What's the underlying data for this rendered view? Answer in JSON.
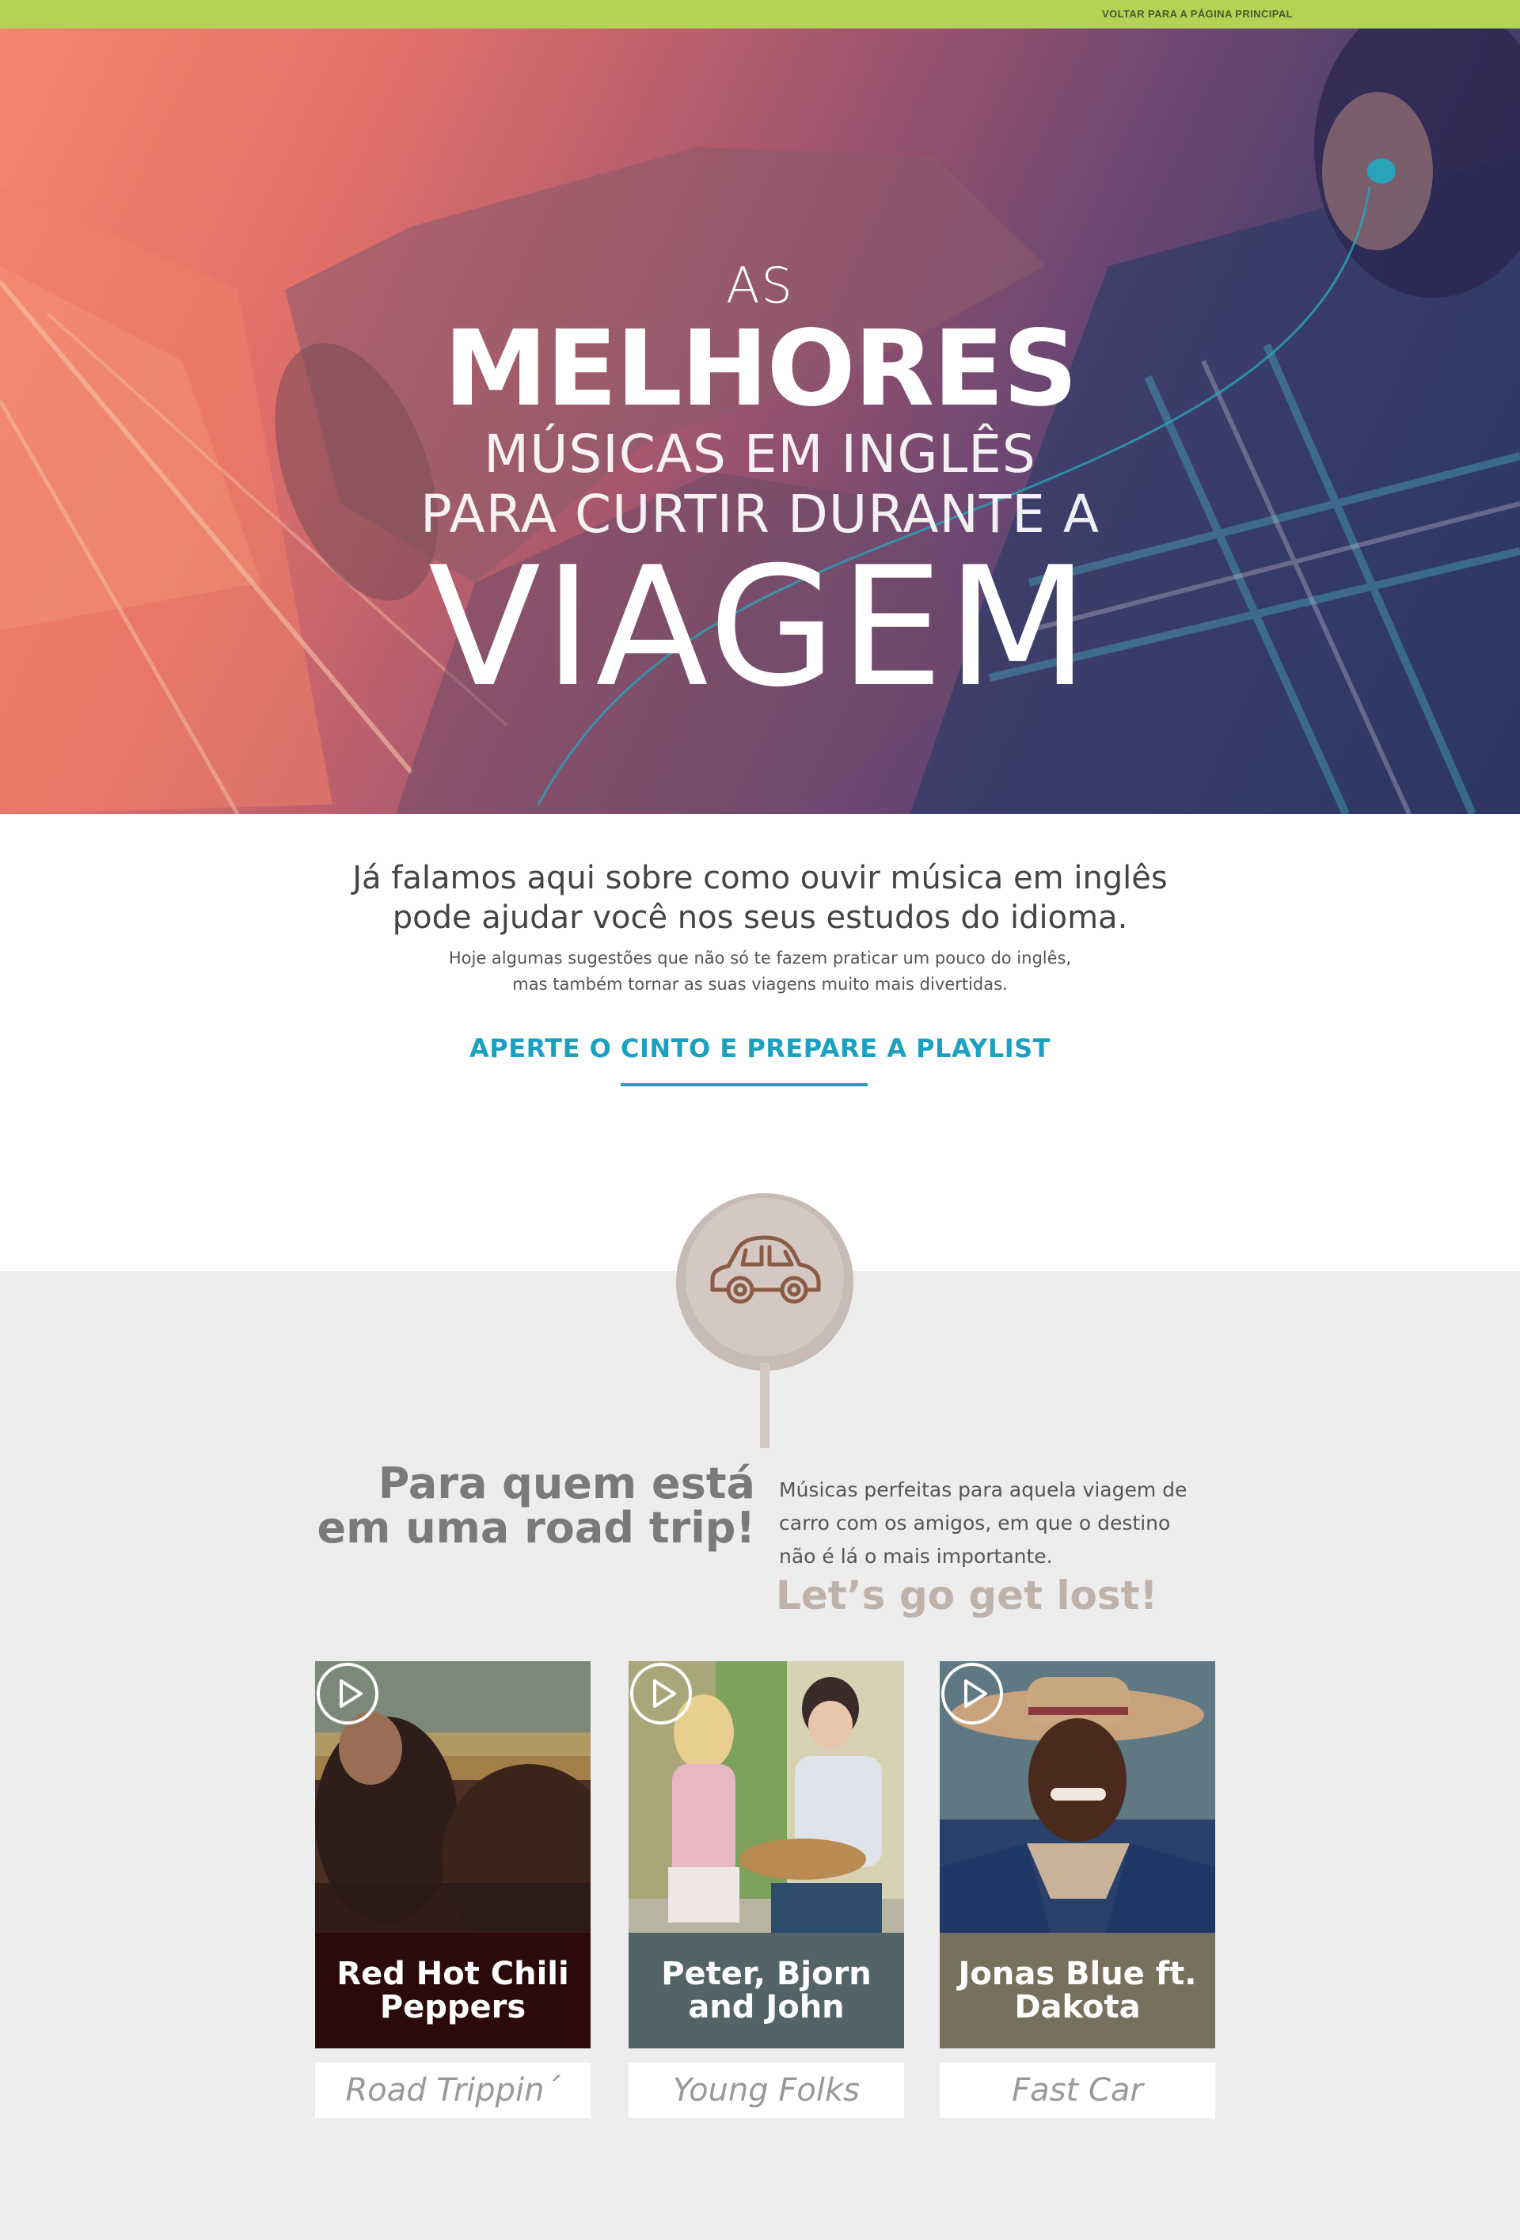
{
  "topbar": {
    "back_link": "VOLTAR PARA A PÁGINA PRINCIPAL"
  },
  "hero": {
    "line1": "AS",
    "line2": "MELHORES",
    "line3": "MÚSICAS EM INGLÊS",
    "line4": "PARA CURTIR DURANTE A",
    "line5": "VIAGEM"
  },
  "intro": {
    "lead_1": "Já falamos aqui sobre como ouvir música em inglês",
    "lead_2": "pode ajudar você nos seus estudos do idioma.",
    "sub_1": "Hoje algumas sugestões que não só te fazem praticar um pouco do inglês,",
    "sub_2": "mas também tornar as suas viagens muito mais divertidas.",
    "cta": "APERTE O CINTO E PREPARE A PLAYLIST"
  },
  "section": {
    "icon": "car-icon",
    "title_1": "Para quem está",
    "title_2": "em uma road trip!",
    "desc_1": "Músicas perfeitas para aquela viagem de",
    "desc_2": "carro com os amigos, em que o destino",
    "desc_3": "não é lá o mais importante.",
    "tagline": "Let’s go get lost!"
  },
  "cards": [
    {
      "artist_1": "Red Hot Chili",
      "artist_2": "Peppers",
      "song": "Road Trippin´",
      "band_color": "#2b0a09"
    },
    {
      "artist_1": "Peter, Bjorn",
      "artist_2": "and John",
      "song": "Young Folks",
      "band_color": "#536469"
    },
    {
      "artist_1": "Jonas Blue ft.",
      "artist_2": "Dakota",
      "song": "Fast Car",
      "band_color": "#77705c"
    }
  ],
  "colors": {
    "accent": "#1ba0c0",
    "topbar": "#b3d356",
    "pin": "#d4c6c1"
  }
}
